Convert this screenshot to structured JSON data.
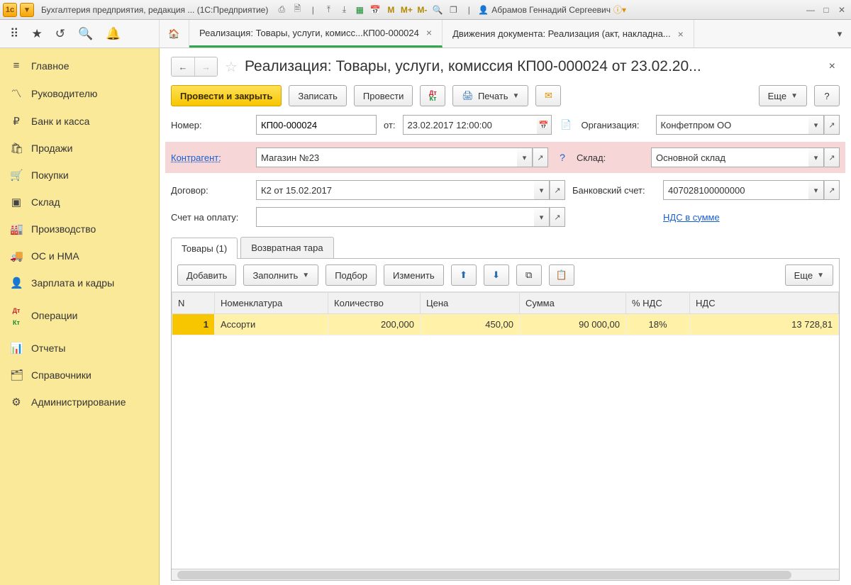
{
  "titlebar": {
    "app_title": "Бухгалтерия предприятия, редакция ... (1С:Предприятие)",
    "user": "Абрамов Геннадий Сергеевич",
    "m": "M",
    "mplus": "M+",
    "mminus": "M-"
  },
  "tabs": {
    "tab1": "Реализация: Товары, услуги, комисс...КП00-000024",
    "tab2": "Движения документа: Реализация (акт, накладна..."
  },
  "sidebar": {
    "items": [
      {
        "label": "Главное"
      },
      {
        "label": "Руководителю"
      },
      {
        "label": "Банк и касса"
      },
      {
        "label": "Продажи"
      },
      {
        "label": "Покупки"
      },
      {
        "label": "Склад"
      },
      {
        "label": "Производство"
      },
      {
        "label": "ОС и НМА"
      },
      {
        "label": "Зарплата и кадры"
      },
      {
        "label": "Операции"
      },
      {
        "label": "Отчеты"
      },
      {
        "label": "Справочники"
      },
      {
        "label": "Администрирование"
      }
    ]
  },
  "doc": {
    "title": "Реализация: Товары, услуги, комиссия КП00-000024 от 23.02.20...",
    "actions": {
      "post_close": "Провести и закрыть",
      "write": "Записать",
      "post": "Провести",
      "print": "Печать",
      "more": "Еще",
      "help": "?"
    },
    "labels": {
      "number": "Номер:",
      "date": "от:",
      "org": "Организация:",
      "contragent": "Контрагент:",
      "warehouse": "Склад:",
      "contract": "Договор:",
      "bank": "Банковский счет:",
      "invoice": "Счет на оплату:",
      "nds": "НДС в сумме"
    },
    "values": {
      "number": "КП00-000024",
      "date": "23.02.2017 12:00:00",
      "org": "Конфетпром ОО",
      "contragent": "Магазин №23",
      "warehouse": "Основной склад",
      "contract": "К2 от 15.02.2017",
      "bank": "407028100000000",
      "invoice": ""
    }
  },
  "subtabs": {
    "goods": "Товары (1)",
    "tare": "Возвратная тара"
  },
  "toolbar": {
    "add": "Добавить",
    "fill": "Заполнить",
    "pick": "Подбор",
    "edit": "Изменить",
    "more": "Еще"
  },
  "table": {
    "headers": {
      "n": "N",
      "nom": "Номенклатура",
      "qty": "Количество",
      "price": "Цена",
      "sum": "Сумма",
      "vatp": "% НДС",
      "vat": "НДС"
    },
    "row": {
      "n": "1",
      "nom": "Ассорти",
      "qty": "200,000",
      "price": "450,00",
      "sum": "90 000,00",
      "vatp": "18%",
      "vat": "13 728,81"
    }
  }
}
